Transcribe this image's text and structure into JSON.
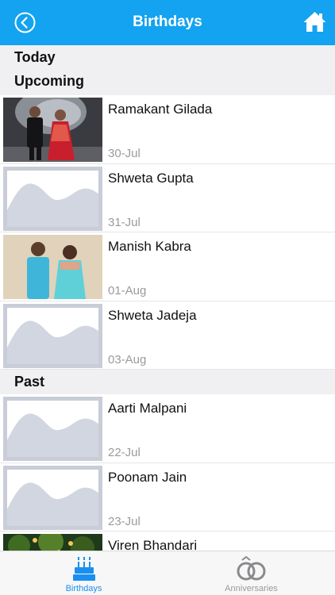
{
  "navbar": {
    "title": "Birthdays",
    "back_icon": "chevron-left-circle-icon",
    "home_icon": "home-icon",
    "color": "#13a3f0"
  },
  "sections": {
    "today": "Today",
    "upcoming": "Upcoming",
    "past": "Past"
  },
  "upcoming": [
    {
      "name": "Ramakant Gilada",
      "date": "30-Jul",
      "photo": "couple-photo"
    },
    {
      "name": "Shweta Gupta",
      "date": "31-Jul",
      "photo": "placeholder"
    },
    {
      "name": "Manish Kabra",
      "date": "01-Aug",
      "photo": "couple-photo"
    },
    {
      "name": "Shweta Jadeja",
      "date": "03-Aug",
      "photo": "placeholder"
    }
  ],
  "past": [
    {
      "name": "Aarti Malpani",
      "date": "22-Jul",
      "photo": "placeholder"
    },
    {
      "name": "Poonam Jain",
      "date": "23-Jul",
      "photo": "placeholder"
    },
    {
      "name": "Viren Bhandari",
      "date": "",
      "photo": "outdoor-photo"
    }
  ],
  "tabbar": {
    "birthdays": {
      "label": "Birthdays",
      "icon": "cake-icon",
      "active": true
    },
    "anniversaries": {
      "label": "Anniversaries",
      "icon": "rings-icon",
      "active": false
    }
  },
  "colors": {
    "active_tab": "#1a8ff0",
    "inactive_tab": "#9a9a9e",
    "section_bg": "#f0f0f2"
  }
}
